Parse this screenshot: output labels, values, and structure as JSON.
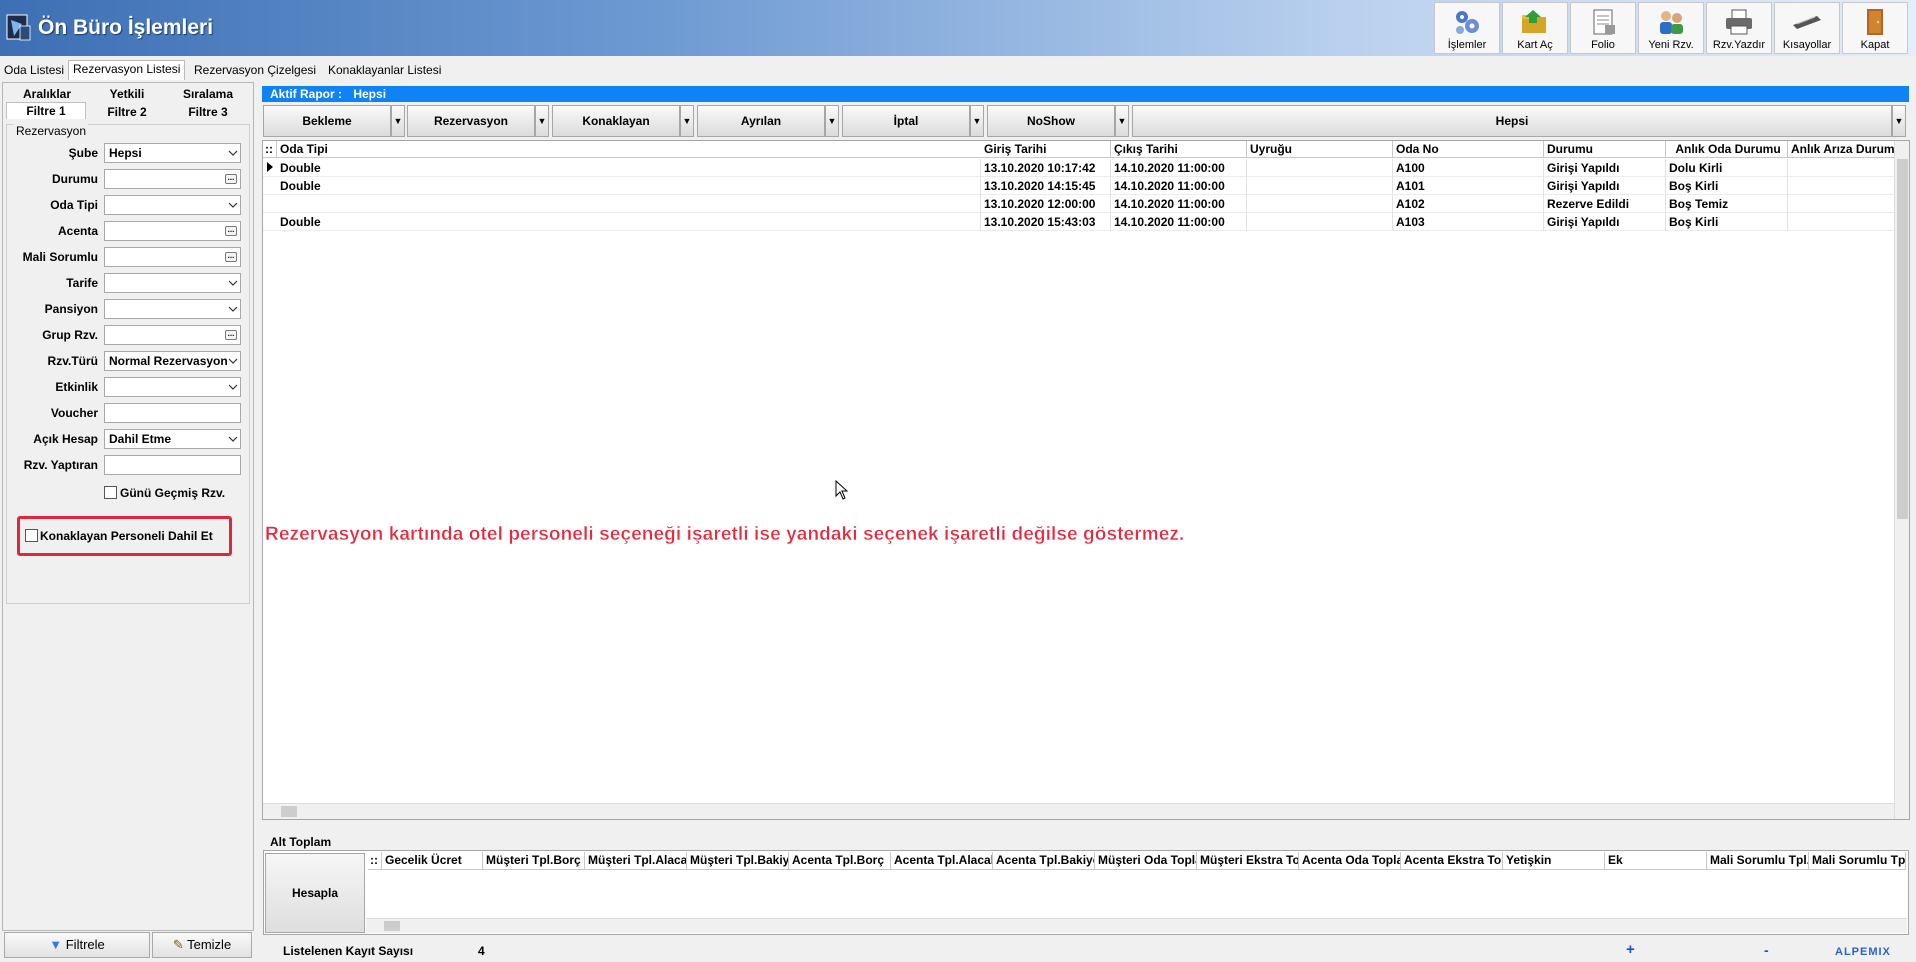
{
  "title": "Ön Büro İşlemleri",
  "toolbar": [
    {
      "label": "İşlemler",
      "icon": "gears-icon"
    },
    {
      "label": "Kart Aç",
      "icon": "open-card-icon"
    },
    {
      "label": "Folio",
      "icon": "folio-icon"
    },
    {
      "label": "Yeni Rzv.",
      "icon": "new-reservation-icon"
    },
    {
      "label": "Rzv.Yazdır",
      "icon": "printer-icon"
    },
    {
      "label": "Kısayollar",
      "icon": "keyboard-icon"
    },
    {
      "label": "Kapat",
      "icon": "exit-door-icon"
    }
  ],
  "tabs": [
    "Oda Listesi",
    "Rezervasyon Listesi",
    "Rezervasyon Çizelgesi",
    "Konaklayanlar Listesi"
  ],
  "filter_tabs_row1": [
    "Aralıklar",
    "Yetkili",
    "Sıralama"
  ],
  "filter_tabs_row2": [
    "Filtre 1",
    "Filtre 2",
    "Filtre 3"
  ],
  "group_label": "Rezervasyon",
  "fields": [
    {
      "label": "Şube",
      "value": "Hepsi",
      "kind": "dropdown"
    },
    {
      "label": "Durumu",
      "value": "",
      "kind": "ellipsis"
    },
    {
      "label": "Oda Tipi",
      "value": "",
      "kind": "dropdown"
    },
    {
      "label": "Acenta",
      "value": "",
      "kind": "ellipsis"
    },
    {
      "label": "Mali Sorumlu",
      "value": "",
      "kind": "ellipsis"
    },
    {
      "label": "Tarife",
      "value": "",
      "kind": "dropdown"
    },
    {
      "label": "Pansiyon",
      "value": "",
      "kind": "dropdown"
    },
    {
      "label": "Grup Rzv.",
      "value": "",
      "kind": "ellipsis"
    },
    {
      "label": "Rzv.Türü",
      "value": "Normal Rezervasyon",
      "kind": "dropdown"
    },
    {
      "label": "Etkinlik",
      "value": "",
      "kind": "dropdown"
    },
    {
      "label": "Voucher",
      "value": "",
      "kind": "text"
    },
    {
      "label": "Açık Hesap",
      "value": "Dahil Etme",
      "kind": "dropdown"
    },
    {
      "label": "Rzv. Yaptıran",
      "value": "",
      "kind": "text"
    }
  ],
  "checkbox_past": "Günü Geçmiş Rzv.",
  "checkbox_staff": "Konaklayan Personeli Dahil Et",
  "buttons": {
    "filter": "Filtrele",
    "clear": "Temizle"
  },
  "aktif_rapor_label": "Aktif Rapor :",
  "aktif_rapor_value": "Hepsi",
  "report_buttons": [
    "Bekleme",
    "Rezervasyon",
    "Konaklayan",
    "Ayrılan",
    "İptal",
    "NoShow",
    "Hepsi"
  ],
  "grid_columns": [
    "Oda Tipi",
    "Giriş Tarihi",
    "Çıkış Tarihi",
    "Uyruğu",
    "Oda No",
    "Durumu",
    "Anlık Oda Durumu",
    "Anlık Arıza Durumu"
  ],
  "grid_rows": [
    [
      "Double",
      "13.10.2020 10:17:42",
      "14.10.2020 11:00:00",
      "",
      "A100",
      "Girişi Yapıldı",
      "Dolu Kirli",
      ""
    ],
    [
      "Double",
      "13.10.2020 14:15:45",
      "14.10.2020 11:00:00",
      "",
      "A101",
      "Girişi Yapıldı",
      "Boş Kirli",
      ""
    ],
    [
      "",
      "13.10.2020 12:00:00",
      "14.10.2020 11:00:00",
      "",
      "A102",
      "Rezerve Edildi",
      "Boş Temiz",
      ""
    ],
    [
      "Double",
      "13.10.2020 15:43:03",
      "14.10.2020 11:00:00",
      "",
      "A103",
      "Girişi Yapıldı",
      "Boş Kirli",
      ""
    ]
  ],
  "annotation": "Rezervasyon kartında  otel personeli seçeneği işaretli ise yandaki seçenek işaretli değilse göstermez.",
  "alt_toplam_label": "Alt Toplam",
  "hesapla": "Hesapla",
  "alt_columns": [
    "Gecelik Ücret",
    "Müşteri Tpl.Borç",
    "Müşteri Tpl.Alacak",
    "Müşteri Tpl.Bakiye",
    "Acenta Tpl.Borç",
    "Acenta Tpl.Alacak",
    "Acenta Tpl.Bakiye",
    "Müşteri Oda Toplam",
    "Müşteri Ekstra Toplam",
    "Acenta Oda Toplam",
    "Acenta Ekstra Toplam",
    "Yetişkin",
    "Ek",
    "Mali Sorumlu Tpl.",
    "Mali Sorumlu Tpl. N"
  ],
  "record_count_label": "Listelenen Kayıt Sayısı",
  "record_count": "4",
  "brand": "ALPEMIX",
  "colors": {
    "accent": "#0f83f6",
    "annotation": "#e8283c"
  }
}
